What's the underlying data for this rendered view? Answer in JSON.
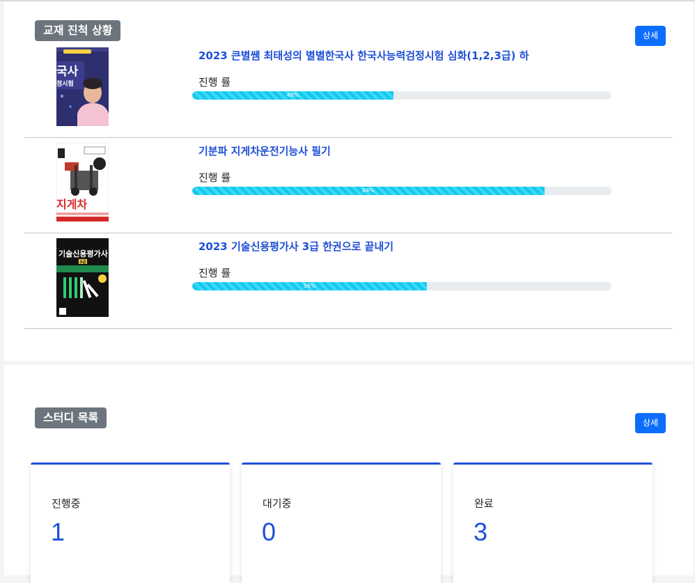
{
  "textbooks": {
    "heading": "교재 진척 상황",
    "detail_button": "상세",
    "progress_label": "진행 률",
    "items": [
      {
        "title": "2023 큰별쌤 최태성의 별별한국사 한국사능력검정시험 심화(1,2,3급) 하",
        "progress": 48,
        "progress_text": "48%",
        "cover_text": [
          "국사",
          "정시험"
        ]
      },
      {
        "title": "기분파 지게차운전기능사 필기",
        "progress": 84,
        "progress_text": "84%",
        "cover_text": [
          "지게차"
        ]
      },
      {
        "title": "2023 기술신용평가사 3급 한권으로 끝내기",
        "progress": 56,
        "progress_text": "56%",
        "cover_text": [
          "기술신용평가사",
          "3급"
        ]
      }
    ]
  },
  "studies": {
    "heading": "스터디 목록",
    "detail_button": "상세",
    "stats": [
      {
        "label": "진행중",
        "value": "1"
      },
      {
        "label": "대기중",
        "value": "0"
      },
      {
        "label": "완료",
        "value": "3"
      }
    ]
  },
  "colors": {
    "accent": "#1e4fd8",
    "button": "#0d6efd",
    "progress": "#0dcaf0",
    "badge": "#6c757d"
  }
}
